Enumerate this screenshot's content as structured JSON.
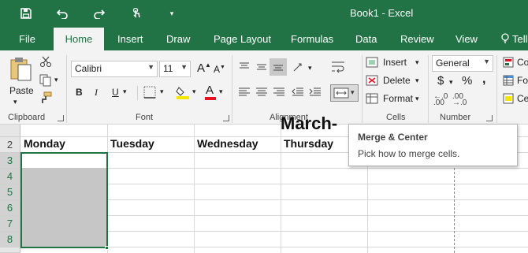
{
  "window": {
    "title": "Book1  -  Excel"
  },
  "tabs": [
    "File",
    "Home",
    "Insert",
    "Draw",
    "Page Layout",
    "Formulas",
    "Data",
    "Review",
    "View",
    "Tell"
  ],
  "clipboard": {
    "paste_label": "Paste",
    "group_label": "Clipboard"
  },
  "font": {
    "name": "Calibri",
    "size": "11",
    "group_label": "Font",
    "bold": "B",
    "italic": "I",
    "underline": "U",
    "grow": "A",
    "shrink": "A",
    "font_color": "A",
    "highlight": "#f5e800",
    "text_color": "#e81123"
  },
  "alignment": {
    "group_label": "Alignment"
  },
  "number": {
    "format": "General",
    "currency": "$",
    "percent": "%",
    "comma": ",",
    "group_label": "Number"
  },
  "cells": {
    "insert": "Insert",
    "delete": "Delete",
    "format": "Format",
    "group_label": "Cells"
  },
  "styles": {
    "item1": "Co",
    "item2": "Fo",
    "item3": "Ce"
  },
  "sheet": {
    "title_partial": "March-",
    "rows": [
      "2",
      "3",
      "4",
      "5",
      "6",
      "7",
      "8"
    ],
    "headers": [
      "Monday",
      "Tuesday",
      "Wednesday",
      "Thursday"
    ]
  },
  "tooltip": {
    "title": "Merge & Center",
    "desc": "Pick how to merge cells."
  }
}
